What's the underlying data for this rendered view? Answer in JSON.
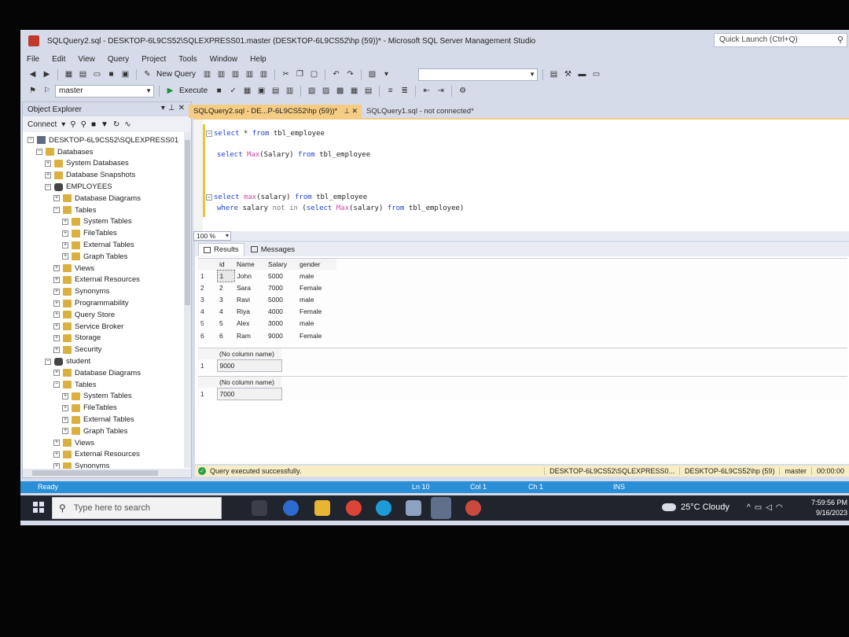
{
  "window": {
    "title": "SQLQuery2.sql - DESKTOP-6L9CS52\\SQLEXPRESS01.master (DESKTOP-6L9CS52\\hp (59))* - Microsoft SQL Server Management Studio",
    "quick_launch_placeholder": "Quick Launch (Ctrl+Q)"
  },
  "menu": [
    "File",
    "Edit",
    "View",
    "Query",
    "Project",
    "Tools",
    "Window",
    "Help"
  ],
  "toolbar": {
    "new_query_label": "New Query",
    "execute_label": "Execute",
    "database": "master"
  },
  "object_explorer": {
    "title": "Object Explorer",
    "connect_label": "Connect",
    "tree": [
      {
        "label": "DESKTOP-6L9CS52\\SQLEXPRESS01",
        "level": 0,
        "icon": "server",
        "expanded": true
      },
      {
        "label": "Databases",
        "level": 1,
        "icon": "folder",
        "expanded": true
      },
      {
        "label": "System Databases",
        "level": 2,
        "icon": "folder",
        "expanded": false
      },
      {
        "label": "Database Snapshots",
        "level": 2,
        "icon": "folder",
        "expanded": false
      },
      {
        "label": "EMPLOYEES",
        "level": 2,
        "icon": "db",
        "expanded": true
      },
      {
        "label": "Database Diagrams",
        "level": 3,
        "icon": "folder",
        "expanded": false
      },
      {
        "label": "Tables",
        "level": 3,
        "icon": "folder",
        "expanded": true
      },
      {
        "label": "System Tables",
        "level": 4,
        "icon": "folder",
        "expanded": false
      },
      {
        "label": "FileTables",
        "level": 4,
        "icon": "folder",
        "expanded": false
      },
      {
        "label": "External Tables",
        "level": 4,
        "icon": "folder",
        "expanded": false
      },
      {
        "label": "Graph Tables",
        "level": 4,
        "icon": "folder",
        "expanded": false
      },
      {
        "label": "Views",
        "level": 3,
        "icon": "folder",
        "expanded": false
      },
      {
        "label": "External Resources",
        "level": 3,
        "icon": "folder",
        "expanded": false
      },
      {
        "label": "Synonyms",
        "level": 3,
        "icon": "folder",
        "expanded": false
      },
      {
        "label": "Programmability",
        "level": 3,
        "icon": "folder",
        "expanded": false
      },
      {
        "label": "Query Store",
        "level": 3,
        "icon": "folder",
        "expanded": false
      },
      {
        "label": "Service Broker",
        "level": 3,
        "icon": "folder",
        "expanded": false
      },
      {
        "label": "Storage",
        "level": 3,
        "icon": "folder",
        "expanded": false
      },
      {
        "label": "Security",
        "level": 3,
        "icon": "folder",
        "expanded": false
      },
      {
        "label": "student",
        "level": 2,
        "icon": "db",
        "expanded": true
      },
      {
        "label": "Database Diagrams",
        "level": 3,
        "icon": "folder",
        "expanded": false
      },
      {
        "label": "Tables",
        "level": 3,
        "icon": "folder",
        "expanded": true
      },
      {
        "label": "System Tables",
        "level": 4,
        "icon": "folder",
        "expanded": false
      },
      {
        "label": "FileTables",
        "level": 4,
        "icon": "folder",
        "expanded": false
      },
      {
        "label": "External Tables",
        "level": 4,
        "icon": "folder",
        "expanded": false
      },
      {
        "label": "Graph Tables",
        "level": 4,
        "icon": "folder",
        "expanded": false
      },
      {
        "label": "Views",
        "level": 3,
        "icon": "folder",
        "expanded": false
      },
      {
        "label": "External Resources",
        "level": 3,
        "icon": "folder",
        "expanded": false
      },
      {
        "label": "Synonyms",
        "level": 3,
        "icon": "folder",
        "expanded": false
      }
    ]
  },
  "tabs": {
    "active": "SQLQuery2.sql - DE...P-6L9CS52\\hp (59))*",
    "inactive": "SQLQuery1.sql - not connected*"
  },
  "editor": {
    "zoom": "100 %"
  },
  "results": {
    "results_tab": "Results",
    "messages_tab": "Messages",
    "columns": [
      "id",
      "Name",
      "Salary",
      "gender"
    ],
    "rows": [
      [
        "1",
        "1",
        "John",
        "5000",
        "male"
      ],
      [
        "2",
        "2",
        "Sara",
        "7000",
        "Female"
      ],
      [
        "3",
        "3",
        "Ravi",
        "5000",
        "male"
      ],
      [
        "4",
        "4",
        "Riya",
        "4000",
        "Female"
      ],
      [
        "5",
        "5",
        "Alex",
        "3000",
        "male"
      ],
      [
        "6",
        "6",
        "Ram",
        "9000",
        "Female"
      ]
    ],
    "grid2": {
      "header": "(No column name)",
      "row_num": "1",
      "value": "9000"
    },
    "grid3": {
      "header": "(No column name)",
      "row_num": "1",
      "value": "7000"
    }
  },
  "query_status": {
    "message": "Query executed successfully.",
    "server": "DESKTOP-6L9CS52\\SQLEXPRESS0...",
    "user": "DESKTOP-6L9CS52\\hp (59)",
    "database": "master",
    "elapsed": "00:00:00"
  },
  "app_status": {
    "state": "Ready",
    "line": "Ln 10",
    "col": "Col 1",
    "ch": "Ch 1",
    "mode": "INS"
  },
  "taskbar": {
    "search_placeholder": "Type here to search",
    "weather": "25°C  Cloudy",
    "time": "7:59:56 PM",
    "date": "9/16/2023"
  },
  "colors": {
    "active_tab": "#f5cc84",
    "status_bar": "#2a8fd6",
    "keyword": "#1f3fd1",
    "function": "#d04aa8"
  }
}
